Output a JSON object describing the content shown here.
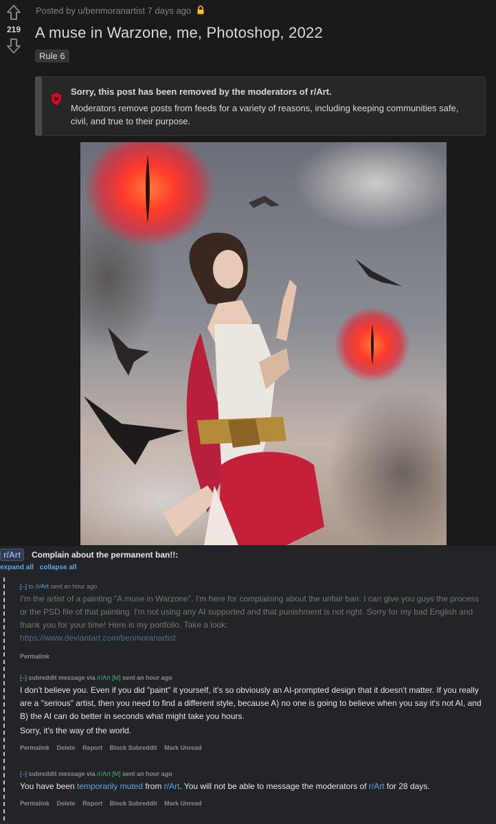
{
  "post": {
    "score": "219",
    "meta": "Posted by u/benmoranartist 7 days ago",
    "title": "A muse in Warzone, me, Photoshop, 2022",
    "flair": "Rule 6",
    "removed_title": "Sorry, this post has been removed by the moderators of r/Art.",
    "removed_body": "Moderators remove posts from feeds for a variety of reasons, including keeping communities safe, civil, and true to their purpose."
  },
  "modmail": {
    "subreddit_badge": "r/Art",
    "subject": "Complain about the permanent ban!!:",
    "expand_all": "expand all",
    "collapse_all": "collapse all",
    "messages": [
      {
        "expander": "[–]",
        "prefix": "to",
        "subreddit": "/r/Art",
        "time": "sent an hour ago",
        "body": "I'm the artist of a painting \"A muse in Warzone\". I'm here for complaining about the unfair ban. I can give you guys the process or the PSD file of that painting. I'm not using any AI supported and that punishment is not right. Sorry for my bad English and thank you for your time! Here is my portfolio. Take a look:",
        "link": "https://www.deviantart.com/benmoranartist",
        "actions": [
          "Permalink"
        ]
      },
      {
        "expander": "[–]",
        "sender": "subreddit message via",
        "subreddit": "/r/Art",
        "mod_tag": "[M]",
        "time": "sent an hour ago",
        "body_lines": [
          "I don't believe you. Even if you did \"paint\" it yourself, it's so obviously an AI-prompted design that it doesn't matter. If you really are a \"serious\" artist, then you need to find a different style, because A) no one is going to believe when you say it's not AI, and B) the AI can do better in seconds what might take you hours.",
          "Sorry, it's the way of the world."
        ],
        "actions": [
          "Permalink",
          "Delete",
          "Report",
          "Block Subreddit",
          "Mark Unread"
        ]
      },
      {
        "expander": "[–]",
        "sender": "subreddit message via",
        "subreddit": "/r/Art",
        "mod_tag": "[M]",
        "time": "sent an hour ago",
        "body_pre": "You have been",
        "body_link1": "temporarily muted",
        "body_mid": "from",
        "body_link2": "r/Art",
        "body_mid2": ". You will not be able to message the moderators of",
        "body_link3": "r/Art",
        "body_post": "for 28 days.",
        "actions": [
          "Permalink",
          "Delete",
          "Report",
          "Block Subreddit",
          "Mark Unread"
        ]
      }
    ]
  },
  "colors": {
    "background": "#1a1a1b",
    "modmail_background": "#222428",
    "link_blue": "#5fa5e8",
    "removed_icon_red": "#ea0027"
  }
}
